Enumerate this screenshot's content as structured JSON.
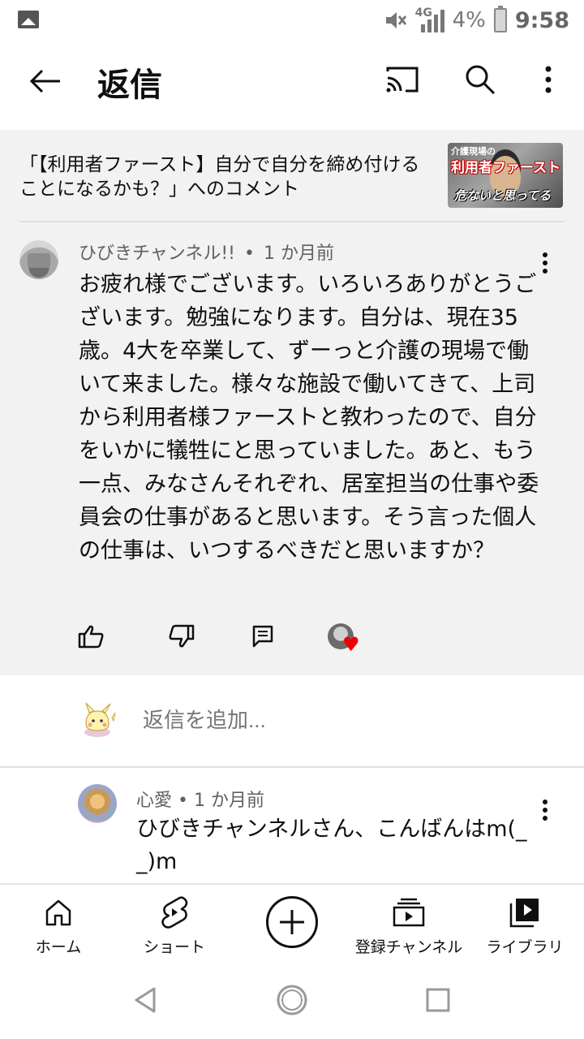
{
  "status_bar": {
    "network": "4G",
    "battery": "4%",
    "time": "9:58"
  },
  "app_bar": {
    "title": "返信"
  },
  "video_ref": {
    "text": "「【利用者ファースト】自分で自分を締め付けることになるかも？」へのコメント",
    "thumb_top": "介護現場の",
    "thumb_title": "利用者ファースト",
    "thumb_bottom": "危ないと思ってる"
  },
  "comment": {
    "author": "ひびきチャンネル!!",
    "sep": "•",
    "time": "1 か月前",
    "text": "お疲れ様でございます。いろいろありがとうございます。勉強になります。自分は、現在35歳。4大を卒業して、ずーっと介護の現場で働いて来ました。様々な施設で働いてきて、上司から利用者様ファーストと教わったので、自分をいかに犠牲にと思っていました。あと、もう一点、みなさんそれぞれ、居室担当の仕事や委員会の仕事があると思います。そう言った個人の仕事は、いつするべきだと思いますか？"
  },
  "add_reply": {
    "placeholder": "返信を追加..."
  },
  "reply": {
    "author": "心愛",
    "sep": "•",
    "time": "1 か月前",
    "text": "ひびきチャンネルさん、こんばんはm(_ _)m"
  },
  "bottom_nav": {
    "home": "ホーム",
    "shorts": "ショート",
    "subscriptions": "登録チャンネル",
    "library": "ライブラリ"
  },
  "colors": {
    "heart": "#e00000",
    "gray_bg": "#f2f2f2"
  }
}
